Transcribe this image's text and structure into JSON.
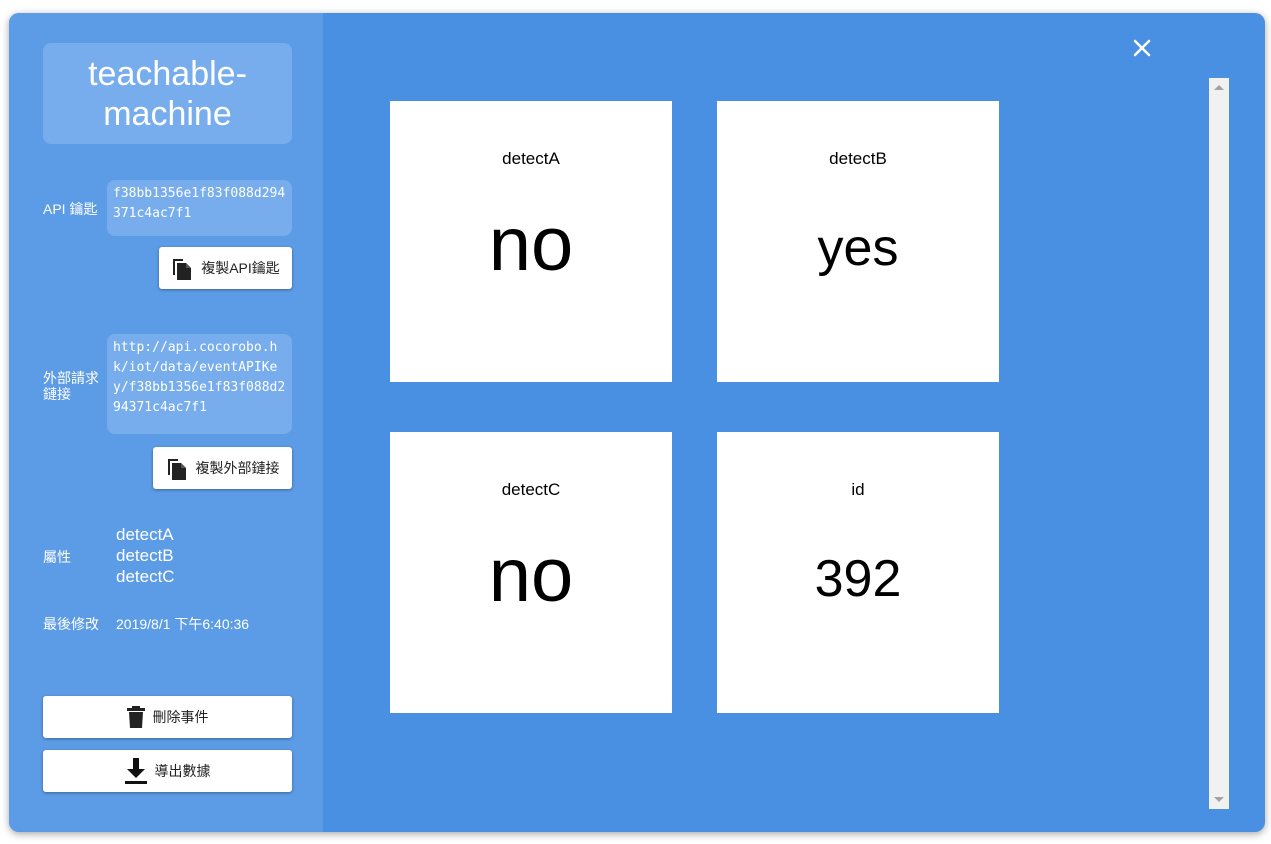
{
  "sidebar": {
    "title": "teachable-machine",
    "api_key_label": "API 鑰匙",
    "api_key": "f38bb1356e1f83f088d294371c4ac7f1",
    "copy_api_label": "複製API鑰匙",
    "external_url_label": "外部請求鏈接",
    "external_url": "http://api.cocorobo.hk/iot/data/eventAPIKey/f38bb1356e1f83f088d294371c4ac7f1",
    "copy_url_label": "複製外部鏈接",
    "attributes_label": "屬性",
    "attributes": [
      "detectA",
      "detectB",
      "detectC"
    ],
    "modified_label": "最後修改",
    "modified_value": "2019/8/1 下午6:40:36",
    "delete_label": "刪除事件",
    "export_label": "導出數據"
  },
  "cards": [
    {
      "name": "detectA",
      "value": "no"
    },
    {
      "name": "detectB",
      "value": "yes"
    },
    {
      "name": "detectC",
      "value": "no"
    },
    {
      "name": "id",
      "value": "392"
    }
  ],
  "colors": {
    "modal_bg": "#4a90e2",
    "sidebar_bg": "#5c9ce6",
    "box_bg": "#77aded"
  },
  "icons": {
    "copy": "copy-icon",
    "trash": "trash-icon",
    "download": "download-icon",
    "close": "close-icon"
  }
}
